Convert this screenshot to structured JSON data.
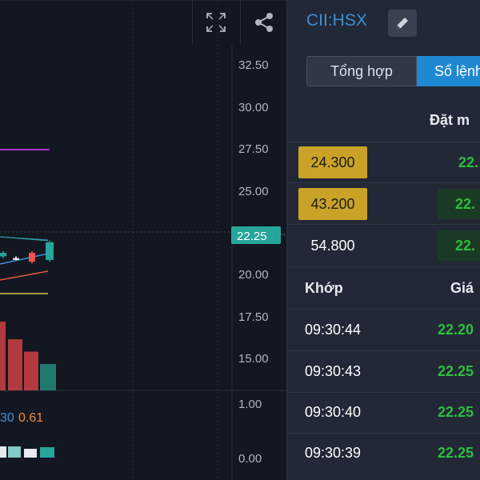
{
  "toolbar": {
    "fullscreen_icon": "fullscreen-icon",
    "share_icon": "share-icon"
  },
  "price_axis": {
    "ticks": [
      "32.50",
      "30.00",
      "27.50",
      "25.00",
      "20.00",
      "17.50",
      "15.00"
    ],
    "current_price": "22.25",
    "current_price_color": "#26a69a"
  },
  "indicator_axis": {
    "ticks": [
      "1.00",
      "0.00"
    ],
    "values": [
      "30",
      "0.61"
    ]
  },
  "chart_data": {
    "type": "bar",
    "series": [
      {
        "values": [
          17.7,
          16.7,
          16.0,
          15.3
        ]
      }
    ],
    "candles": [
      {
        "open": 21.4,
        "close": 21.6,
        "high": 21.7,
        "low": 21.3,
        "color": "#26a69a"
      },
      {
        "open": 21.3,
        "close": 21.3,
        "high": 21.4,
        "low": 21.2,
        "color": "#ffffff"
      },
      {
        "open": 21.6,
        "close": 21.1,
        "high": 21.7,
        "low": 21.0,
        "color": "#ef5350"
      },
      {
        "open": 21.2,
        "close": 22.2,
        "high": 22.3,
        "low": 21.1,
        "color": "#26a69a"
      }
    ],
    "ylim": [
      13.8,
      33.4
    ]
  },
  "book": {
    "symbol": "CII:HSX",
    "tabs": [
      "Tổng hợp",
      "Sổ lệnh"
    ],
    "header": "Đặt m",
    "rows": [
      {
        "price": "24.300",
        "bid": "22.",
        "highlight": true,
        "bid_highlight": false
      },
      {
        "price": "43.200",
        "bid": "22.",
        "highlight": true,
        "bid_highlight": true
      },
      {
        "price": "54.800",
        "bid": "22.",
        "highlight": false,
        "bid_highlight": true
      }
    ],
    "trades_header": {
      "time": "Khớp",
      "price": "Giá"
    },
    "trades": [
      {
        "time": "09:30:44",
        "price": "22.20"
      },
      {
        "time": "09:30:43",
        "price": "22.25"
      },
      {
        "time": "09:30:40",
        "price": "22.25"
      },
      {
        "time": "09:30:39",
        "price": "22.25"
      }
    ]
  }
}
